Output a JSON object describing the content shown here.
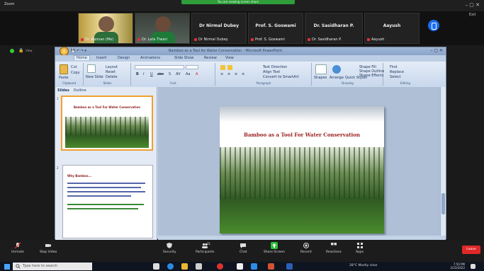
{
  "zoom_window": {
    "app_label": "Zoom",
    "banner": "You are viewing screen share",
    "window_controls": "–  ▢  ✕",
    "view_label": "View",
    "fullscreen_label": "Exit"
  },
  "participants": [
    {
      "name": "Dr. Kannan (Me)",
      "type": "video"
    },
    {
      "name": "Dr. Lata Tiwari",
      "type": "video"
    },
    {
      "name": "Dr Nirmal Dubey",
      "type": "plain"
    },
    {
      "name": "Prof. S. Goswami",
      "type": "plain"
    },
    {
      "name": "Dr. Sasidharan P.",
      "type": "plain"
    },
    {
      "name": "Aayush",
      "type": "plain"
    }
  ],
  "powerpoint": {
    "title": "Bamboo as a Tool for Water Conservation - Microsoft PowerPoint",
    "quick_access": "💾 ↶ ↷ ▾",
    "window_controls": "–  ▢  ✕",
    "tabs": [
      "Home",
      "Insert",
      "Design",
      "Animations",
      "Slide Show",
      "Review",
      "View"
    ],
    "ribbon_groups": [
      {
        "label": "Clipboard",
        "buttons": [
          "Paste",
          "Cut",
          "Copy",
          "Format Painter"
        ]
      },
      {
        "label": "Slides",
        "buttons": [
          "New Slide",
          "Layout",
          "Reset",
          "Delete"
        ]
      },
      {
        "label": "Font",
        "buttons": [
          "B",
          "I",
          "U",
          "abc",
          "S",
          "AV",
          "Aa",
          "A"
        ]
      },
      {
        "label": "Paragraph",
        "buttons": [
          "≡",
          "≡",
          "≡",
          "≡",
          "Text Direction",
          "Align Text",
          "Convert to SmartArt"
        ]
      },
      {
        "label": "Drawing",
        "buttons": [
          "Shapes",
          "Arrange",
          "Quick Styles",
          "Shape Fill",
          "Shape Outline",
          "Shape Effects"
        ]
      },
      {
        "label": "Editing",
        "buttons": [
          "Find",
          "Replace",
          "Select"
        ]
      }
    ],
    "pane_tabs": [
      "Slides",
      "Outline"
    ],
    "thumbnails": [
      {
        "number": "1",
        "title": "Bamboo as a Tool For Water Conservation"
      },
      {
        "number": "2",
        "title": "Why Bamboo..."
      }
    ],
    "current_slide_title": "Bamboo as a Tool For Water Conservation"
  },
  "toolbar": {
    "buttons": [
      "Unmute",
      "Stop Video",
      "Security",
      "Participants",
      "Chat",
      "Share Screen",
      "Record",
      "Reactions",
      "Apps"
    ],
    "participant_count": "31",
    "end_label": "Leave"
  },
  "taskbar": {
    "search_placeholder": "Type here to search",
    "weather": "28°C Mostly clear",
    "time": "7:50 PM",
    "date": "2/23/2022"
  }
}
